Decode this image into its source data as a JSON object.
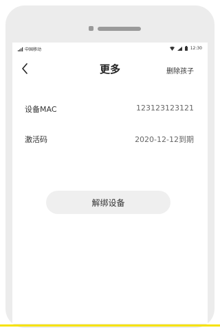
{
  "status_bar": {
    "carrier": "中国移动",
    "time": "12:30"
  },
  "nav": {
    "title": "更多",
    "action_label": "删除孩子"
  },
  "rows": [
    {
      "label": "设备MAC",
      "value": "123123123121"
    },
    {
      "label": "激活码",
      "value": "2020-12-12到期"
    }
  ],
  "unbind_button": {
    "label": "解绑设备"
  },
  "colors": {
    "accent_yellow": "#f6e200",
    "frame": "#ececec",
    "button_bg": "#efefef"
  },
  "icons": {
    "back": "chevron-left-icon",
    "wifi": "wifi-icon",
    "signal": "signal-icon",
    "battery": "battery-icon"
  }
}
